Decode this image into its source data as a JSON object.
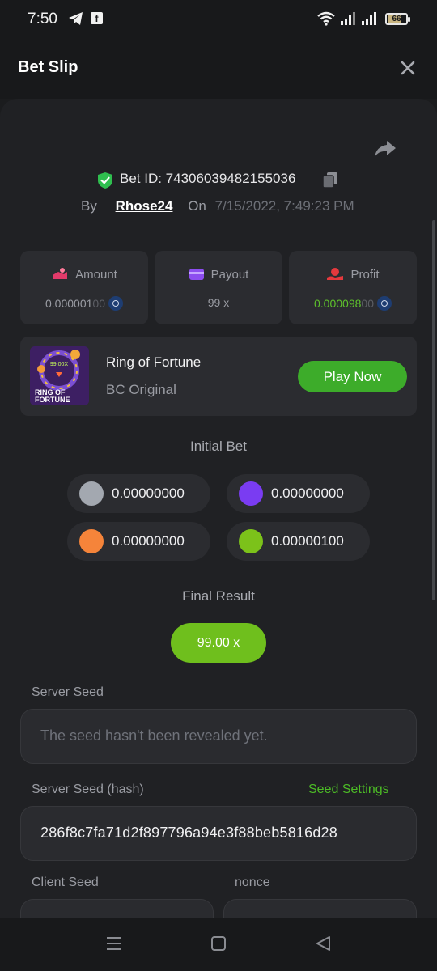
{
  "status_bar": {
    "time": "7:50",
    "battery": "66"
  },
  "header": {
    "title": "Bet Slip"
  },
  "bet": {
    "id_text": "Bet ID: 74306039482155036",
    "by_label": "By",
    "username": "Rhose24",
    "on_label": "On",
    "date": "7/15/2022, 7:49:23 PM"
  },
  "stats": {
    "amount": {
      "label": "Amount",
      "value_main": "0.000001",
      "value_dim": "00"
    },
    "payout": {
      "label": "Payout",
      "value": "99 x"
    },
    "profit": {
      "label": "Profit",
      "value_main": "0.000098",
      "value_dim": "00"
    }
  },
  "game": {
    "thumb_multiplier": "99.00X",
    "thumb_title_1": "RING OF",
    "thumb_title_2": "FORTUNE",
    "name": "Ring of Fortune",
    "subtitle": "BC Original",
    "play_label": "Play Now"
  },
  "initial_bet": {
    "title": "Initial Bet",
    "chips": [
      {
        "color": "#a3a8b0",
        "amount": "0.00000000"
      },
      {
        "color": "#7a3cf2",
        "amount": "0.00000000"
      },
      {
        "color": "#f5843a",
        "amount": "0.00000000"
      },
      {
        "color": "#7cc21a",
        "amount": "0.00000100"
      }
    ]
  },
  "final_result": {
    "title": "Final Result",
    "value": "99.00 x"
  },
  "server_seed": {
    "label": "Server Seed",
    "placeholder": "The seed hasn't been revealed yet."
  },
  "server_seed_hash": {
    "label": "Server Seed (hash)",
    "settings_link": "Seed Settings",
    "value": "286f8c7fa71d2f897796a94e3f88beb5816d28"
  },
  "client_seed": {
    "label": "Client Seed"
  },
  "nonce": {
    "label": "nonce"
  },
  "colors": {
    "accent_green": "#3dac2a",
    "result_green": "#6fbf1d",
    "shield_green": "#2fbf4f",
    "profit_green": "#5ec12b"
  },
  "icons": [
    "telegram-icon",
    "facebook-icon",
    "wifi-icon",
    "signal-icon",
    "battery-icon",
    "close-icon",
    "share-icon",
    "shield-check-icon",
    "copy-icon",
    "amount-icon",
    "payout-icon",
    "profit-icon",
    "coin-icon",
    "menu-nav-icon",
    "home-nav-icon",
    "back-nav-icon"
  ]
}
